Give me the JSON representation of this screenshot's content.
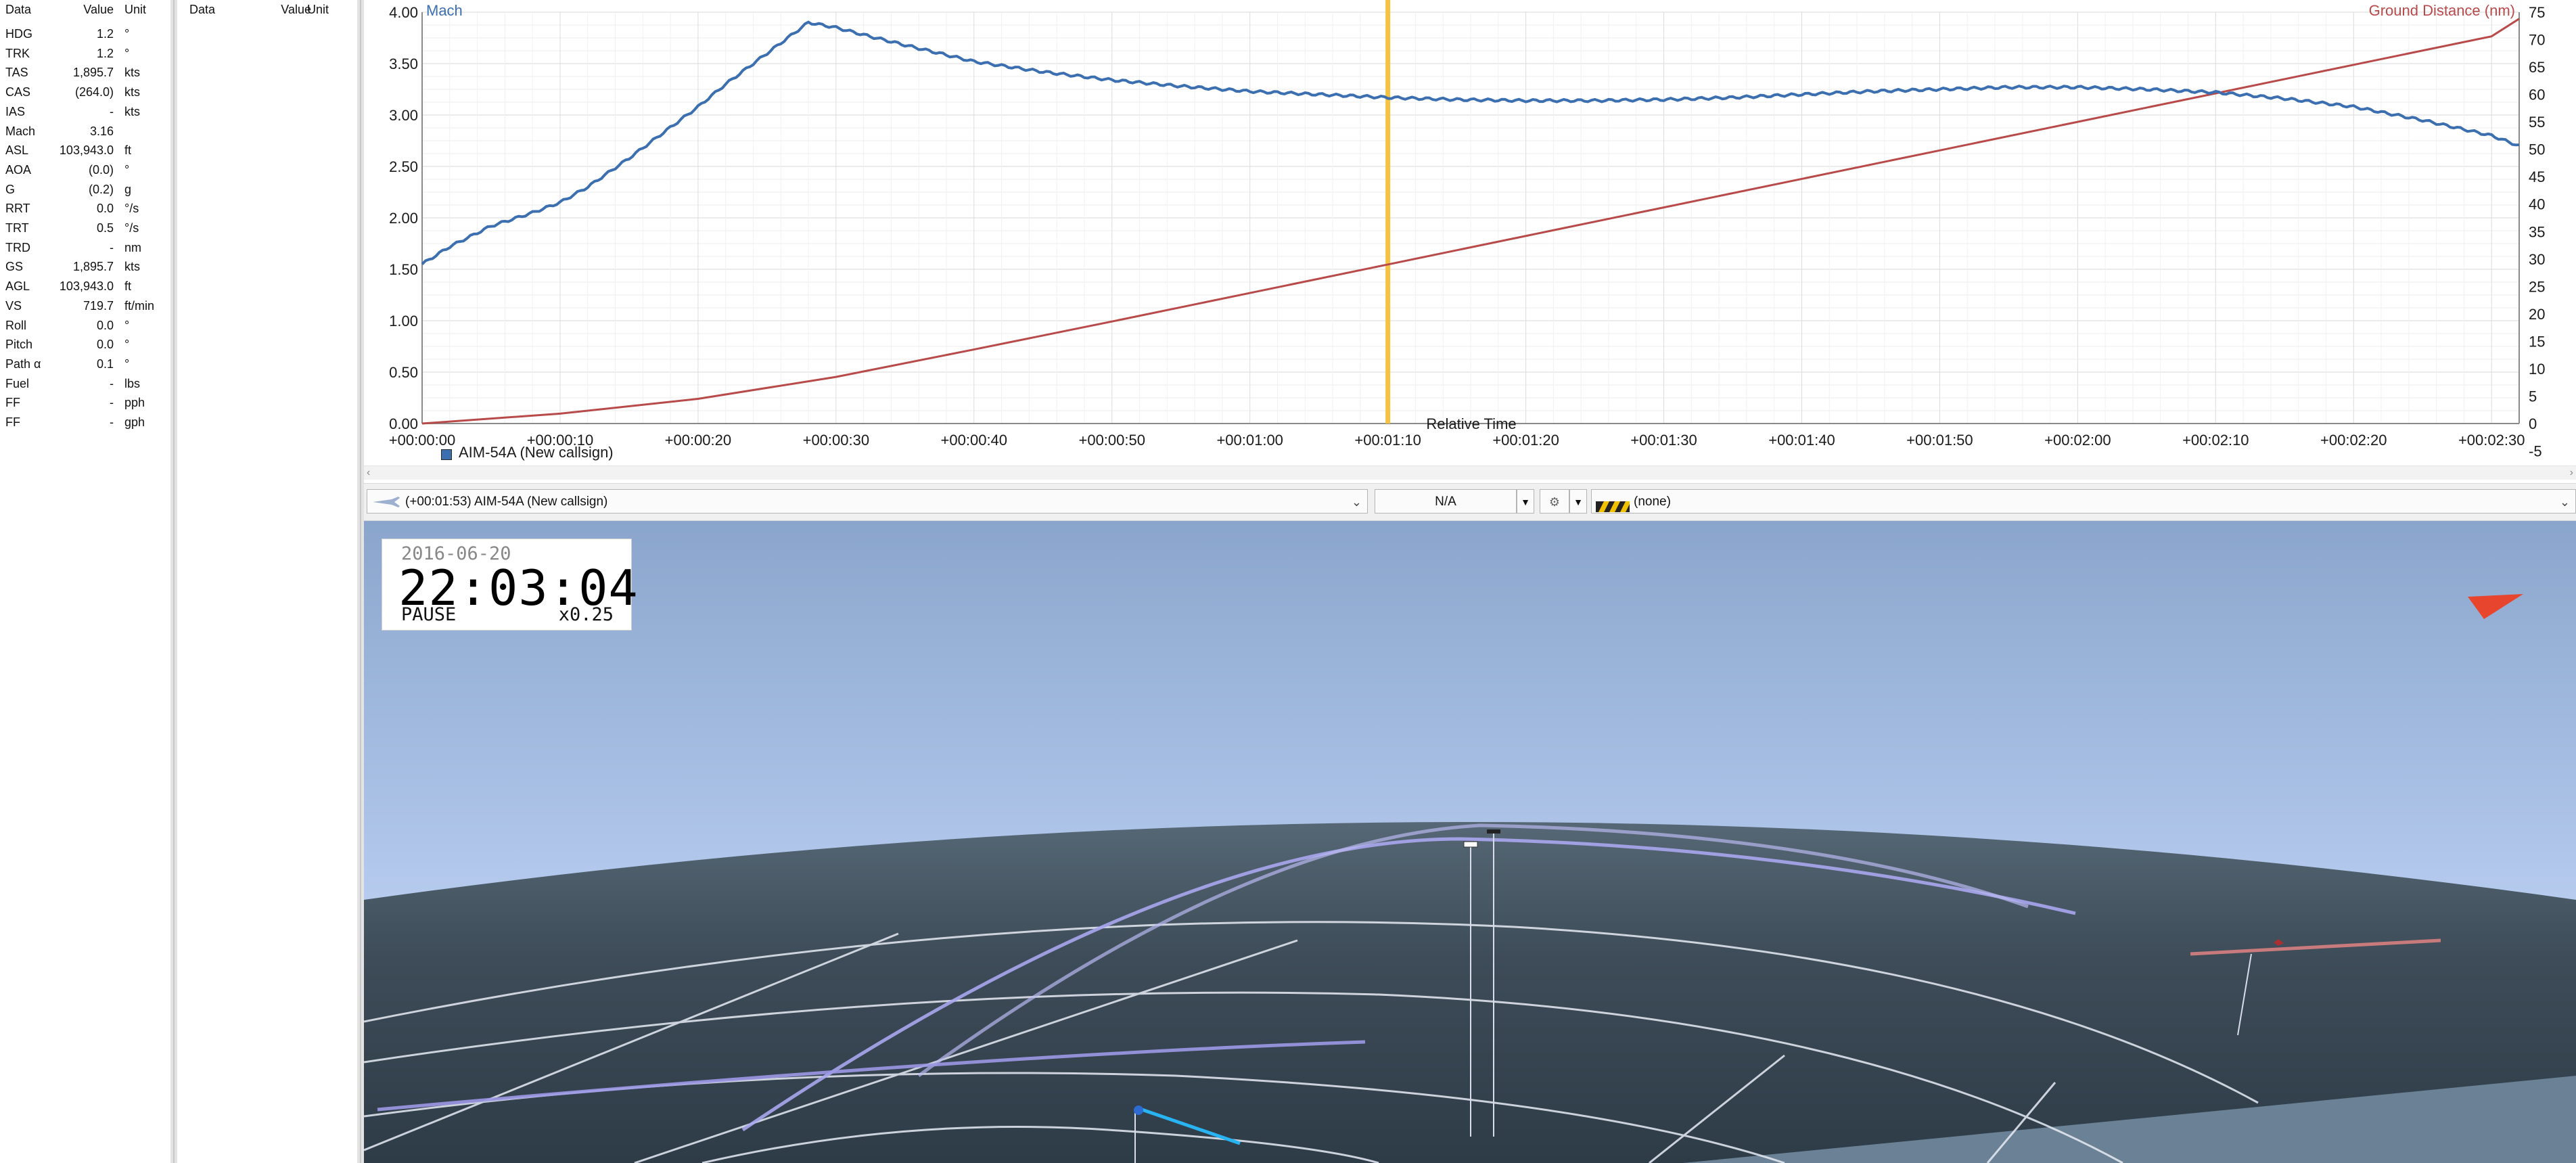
{
  "left_table": {
    "headers": {
      "name": "Data",
      "value": "Value",
      "unit": "Unit"
    },
    "rows": [
      {
        "name": "HDG",
        "value": "1.2",
        "unit": "°"
      },
      {
        "name": "TRK",
        "value": "1.2",
        "unit": "°"
      },
      {
        "name": "TAS",
        "value": "1,895.7",
        "unit": "kts"
      },
      {
        "name": "CAS",
        "value": "(264.0)",
        "unit": "kts"
      },
      {
        "name": "IAS",
        "value": "-",
        "unit": "kts"
      },
      {
        "name": "Mach",
        "value": "3.16",
        "unit": ""
      },
      {
        "name": "ASL",
        "value": "103,943.0",
        "unit": "ft"
      },
      {
        "name": "AOA",
        "value": "(0.0)",
        "unit": "°"
      },
      {
        "name": "G",
        "value": "(0.2)",
        "unit": "g"
      },
      {
        "name": "RRT",
        "value": "0.0",
        "unit": "°/s"
      },
      {
        "name": "TRT",
        "value": "0.5",
        "unit": "°/s"
      },
      {
        "name": "TRD",
        "value": "-",
        "unit": "nm"
      },
      {
        "name": "GS",
        "value": "1,895.7",
        "unit": "kts"
      },
      {
        "name": "AGL",
        "value": "103,943.0",
        "unit": "ft"
      },
      {
        "name": "VS",
        "value": "719.7",
        "unit": "ft/min"
      },
      {
        "name": "Roll",
        "value": "0.0",
        "unit": "°"
      },
      {
        "name": "Pitch",
        "value": "0.0",
        "unit": "°"
      },
      {
        "name": "Path α",
        "value": "0.1",
        "unit": "°"
      },
      {
        "name": "Fuel",
        "value": "-",
        "unit": "lbs"
      },
      {
        "name": "FF",
        "value": "-",
        "unit": "pph"
      },
      {
        "name": "FF",
        "value": "-",
        "unit": "gph"
      }
    ]
  },
  "right_table": {
    "headers": {
      "name": "Data",
      "value": "Value",
      "unit": "Unit"
    }
  },
  "chart_data": {
    "type": "line",
    "xlabel": "Relative Time",
    "x_ticks": [
      "+00:00:00",
      "+00:00:10",
      "+00:00:20",
      "+00:00:30",
      "+00:00:40",
      "+00:00:50",
      "+00:01:00",
      "+00:01:10",
      "+00:01:20",
      "+00:01:30",
      "+00:01:40",
      "+00:01:50",
      "+00:02:00",
      "+00:02:10",
      "+00:02:20",
      "+00:02:30"
    ],
    "xlim_seconds": [
      0,
      152
    ],
    "y_left": {
      "label": "Mach",
      "ylim": [
        0,
        4
      ],
      "ticks": [
        "0.00",
        "0.50",
        "1.00",
        "1.50",
        "2.00",
        "2.50",
        "3.00",
        "3.50",
        "4.00"
      ]
    },
    "y_right": {
      "label": "Ground Distance (nm)",
      "ylim": [
        -5,
        75
      ],
      "ticks": [
        "-5",
        "0",
        "5",
        "10",
        "15",
        "20",
        "25",
        "30",
        "35",
        "40",
        "45",
        "50",
        "55",
        "60",
        "65",
        "70",
        "75"
      ]
    },
    "cursor_time_seconds": 70,
    "series": [
      {
        "name": "Mach",
        "axis": "left",
        "color": "#3c6fb0",
        "x": [
          0,
          2,
          5,
          8,
          10,
          12,
          15,
          18,
          20,
          22,
          25,
          28,
          30,
          32,
          35,
          40,
          45,
          50,
          55,
          60,
          65,
          70,
          75,
          80,
          85,
          90,
          95,
          100,
          105,
          110,
          115,
          120,
          125,
          130,
          135,
          140,
          145,
          150,
          152
        ],
        "values": [
          1.55,
          1.72,
          1.92,
          2.05,
          2.15,
          2.3,
          2.58,
          2.88,
          3.08,
          3.3,
          3.6,
          3.9,
          3.85,
          3.78,
          3.68,
          3.52,
          3.42,
          3.34,
          3.28,
          3.23,
          3.2,
          3.17,
          3.15,
          3.14,
          3.14,
          3.15,
          3.17,
          3.2,
          3.23,
          3.25,
          3.27,
          3.27,
          3.25,
          3.22,
          3.16,
          3.08,
          2.95,
          2.8,
          2.7
        ]
      },
      {
        "name": "Ground Distance (nm)",
        "axis": "right",
        "color": "#b84a4a",
        "x": [
          0,
          10,
          20,
          30,
          40,
          50,
          60,
          70,
          80,
          90,
          100,
          110,
          120,
          130,
          140,
          150,
          152
        ],
        "values": [
          0.0,
          1.8,
          4.5,
          8.5,
          13.5,
          18.6,
          23.8,
          29.0,
          34.2,
          39.4,
          44.6,
          49.8,
          55.0,
          60.2,
          65.4,
          70.6,
          73.8
        ]
      }
    ],
    "legend": [
      {
        "label": "AIM-54A (New callsign)",
        "color": "#3c6fb0"
      }
    ]
  },
  "toolbar": {
    "object_select": "(+00:01:53) AIM-54A (New callsign)",
    "second_select": "N/A",
    "third_select": "(none)"
  },
  "clock": {
    "date": "2016-06-20",
    "time": "22:03:04",
    "state": "PAUSE",
    "speed": "x0.25"
  },
  "colors": {
    "mach_line": "#3c6fb0",
    "distance_line": "#b84a4a",
    "cursor": "#f5c242",
    "sky_top": "#8aa5cc",
    "sky_horizon": "#c6d8f4",
    "earth": "#3e4b56"
  }
}
